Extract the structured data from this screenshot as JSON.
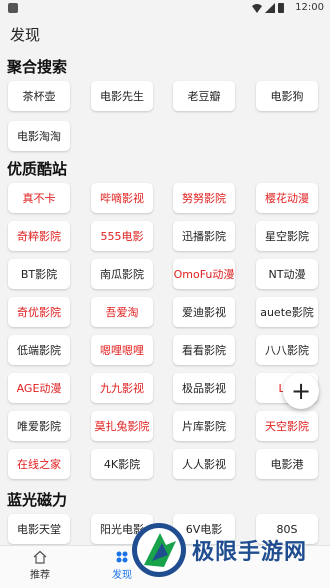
{
  "status": {
    "time": "12:00"
  },
  "appbar": {
    "title": "发现"
  },
  "sections": {
    "aggregate": {
      "title": "聚合搜索",
      "items": [
        {
          "label": "茶杯壶",
          "color": "#222222"
        },
        {
          "label": "电影先生",
          "color": "#222222"
        },
        {
          "label": "老豆瓣",
          "color": "#222222"
        },
        {
          "label": "电影狗",
          "color": "#222222"
        },
        {
          "label": "电影淘淘",
          "color": "#222222"
        }
      ]
    },
    "quality": {
      "title": "优质酷站",
      "items": [
        {
          "label": "真不卡",
          "color": "#e02020"
        },
        {
          "label": "哔嘀影视",
          "color": "#e02020"
        },
        {
          "label": "努努影院",
          "color": "#e02020"
        },
        {
          "label": "樱花动漫",
          "color": "#e02020"
        },
        {
          "label": "奇粹影院",
          "color": "#e02020"
        },
        {
          "label": "555电影",
          "color": "#e02020"
        },
        {
          "label": "迅播影院",
          "color": "#222222"
        },
        {
          "label": "星空影院",
          "color": "#222222"
        },
        {
          "label": "BT影院",
          "color": "#222222"
        },
        {
          "label": "南瓜影院",
          "color": "#222222"
        },
        {
          "label": "OmoFu动漫",
          "color": "#e02020"
        },
        {
          "label": "NT动漫",
          "color": "#222222"
        },
        {
          "label": "奇优影院",
          "color": "#e02020"
        },
        {
          "label": "吾爱淘",
          "color": "#e02020"
        },
        {
          "label": "爱迪影视",
          "color": "#222222"
        },
        {
          "label": "auete影院",
          "color": "#222222"
        },
        {
          "label": "低端影院",
          "color": "#222222"
        },
        {
          "label": "嗯哩嗯哩",
          "color": "#e02020"
        },
        {
          "label": "看看影院",
          "color": "#222222"
        },
        {
          "label": "八八影院",
          "color": "#222222"
        },
        {
          "label": "AGE动漫",
          "color": "#e02020"
        },
        {
          "label": "九九影视",
          "color": "#e02020"
        },
        {
          "label": "极品影视",
          "color": "#222222"
        },
        {
          "label": "LIB",
          "color": "#e02020"
        },
        {
          "label": "唯爱影院",
          "color": "#222222"
        },
        {
          "label": "莫扎兔影院",
          "color": "#e02020"
        },
        {
          "label": "片库影院",
          "color": "#222222"
        },
        {
          "label": "天空影院",
          "color": "#e02020"
        },
        {
          "label": "在线之家",
          "color": "#e02020"
        },
        {
          "label": "4K影院",
          "color": "#222222"
        },
        {
          "label": "人人影视",
          "color": "#222222"
        },
        {
          "label": "电影港",
          "color": "#222222"
        }
      ]
    },
    "bluray": {
      "title": "蓝光磁力",
      "items": [
        {
          "label": "电影天堂",
          "color": "#222222"
        },
        {
          "label": "阳光电影",
          "color": "#222222"
        },
        {
          "label": "6V电影",
          "color": "#222222"
        },
        {
          "label": "80S",
          "color": "#222222"
        }
      ]
    }
  },
  "fab": {
    "label": "+"
  },
  "bottom_nav": [
    {
      "label": "推荐",
      "icon": "home-icon"
    },
    {
      "label": "发现",
      "icon": "discover-icon"
    }
  ],
  "watermark": {
    "text": "极限手游网"
  }
}
